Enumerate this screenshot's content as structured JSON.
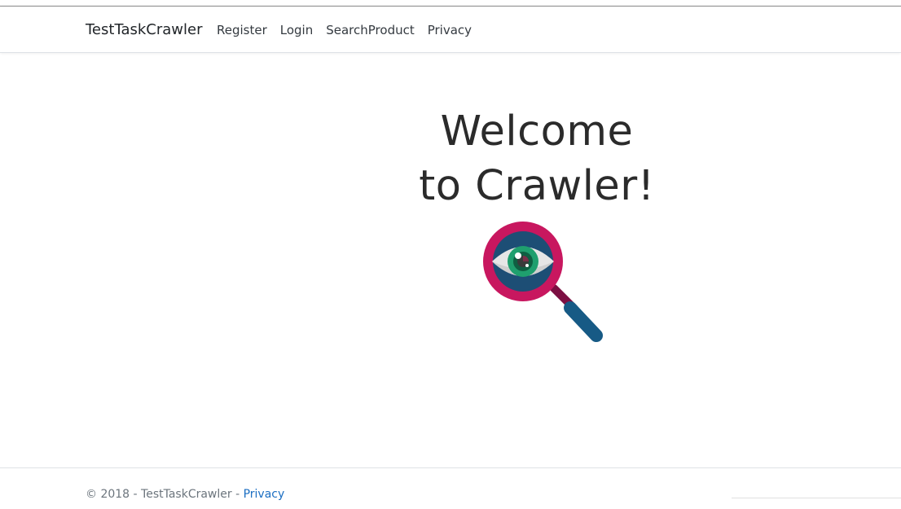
{
  "navbar": {
    "brand": "TestTaskCrawler",
    "links": [
      {
        "label": "Register"
      },
      {
        "label": "Login"
      },
      {
        "label": "SearchProduct"
      },
      {
        "label": "Privacy"
      }
    ]
  },
  "hero": {
    "line1": "Welcome",
    "line2": "to Crawler!",
    "logo_icon": "magnifier-eye-icon"
  },
  "footer": {
    "copyright": "© 2018 - TestTaskCrawler - ",
    "privacy_link": "Privacy"
  },
  "colors": {
    "ring": "#c8175f",
    "inner": "#1d4e75",
    "iris": "#1f9f6e",
    "handle": "#175a85",
    "link": "#1b6ec2"
  }
}
